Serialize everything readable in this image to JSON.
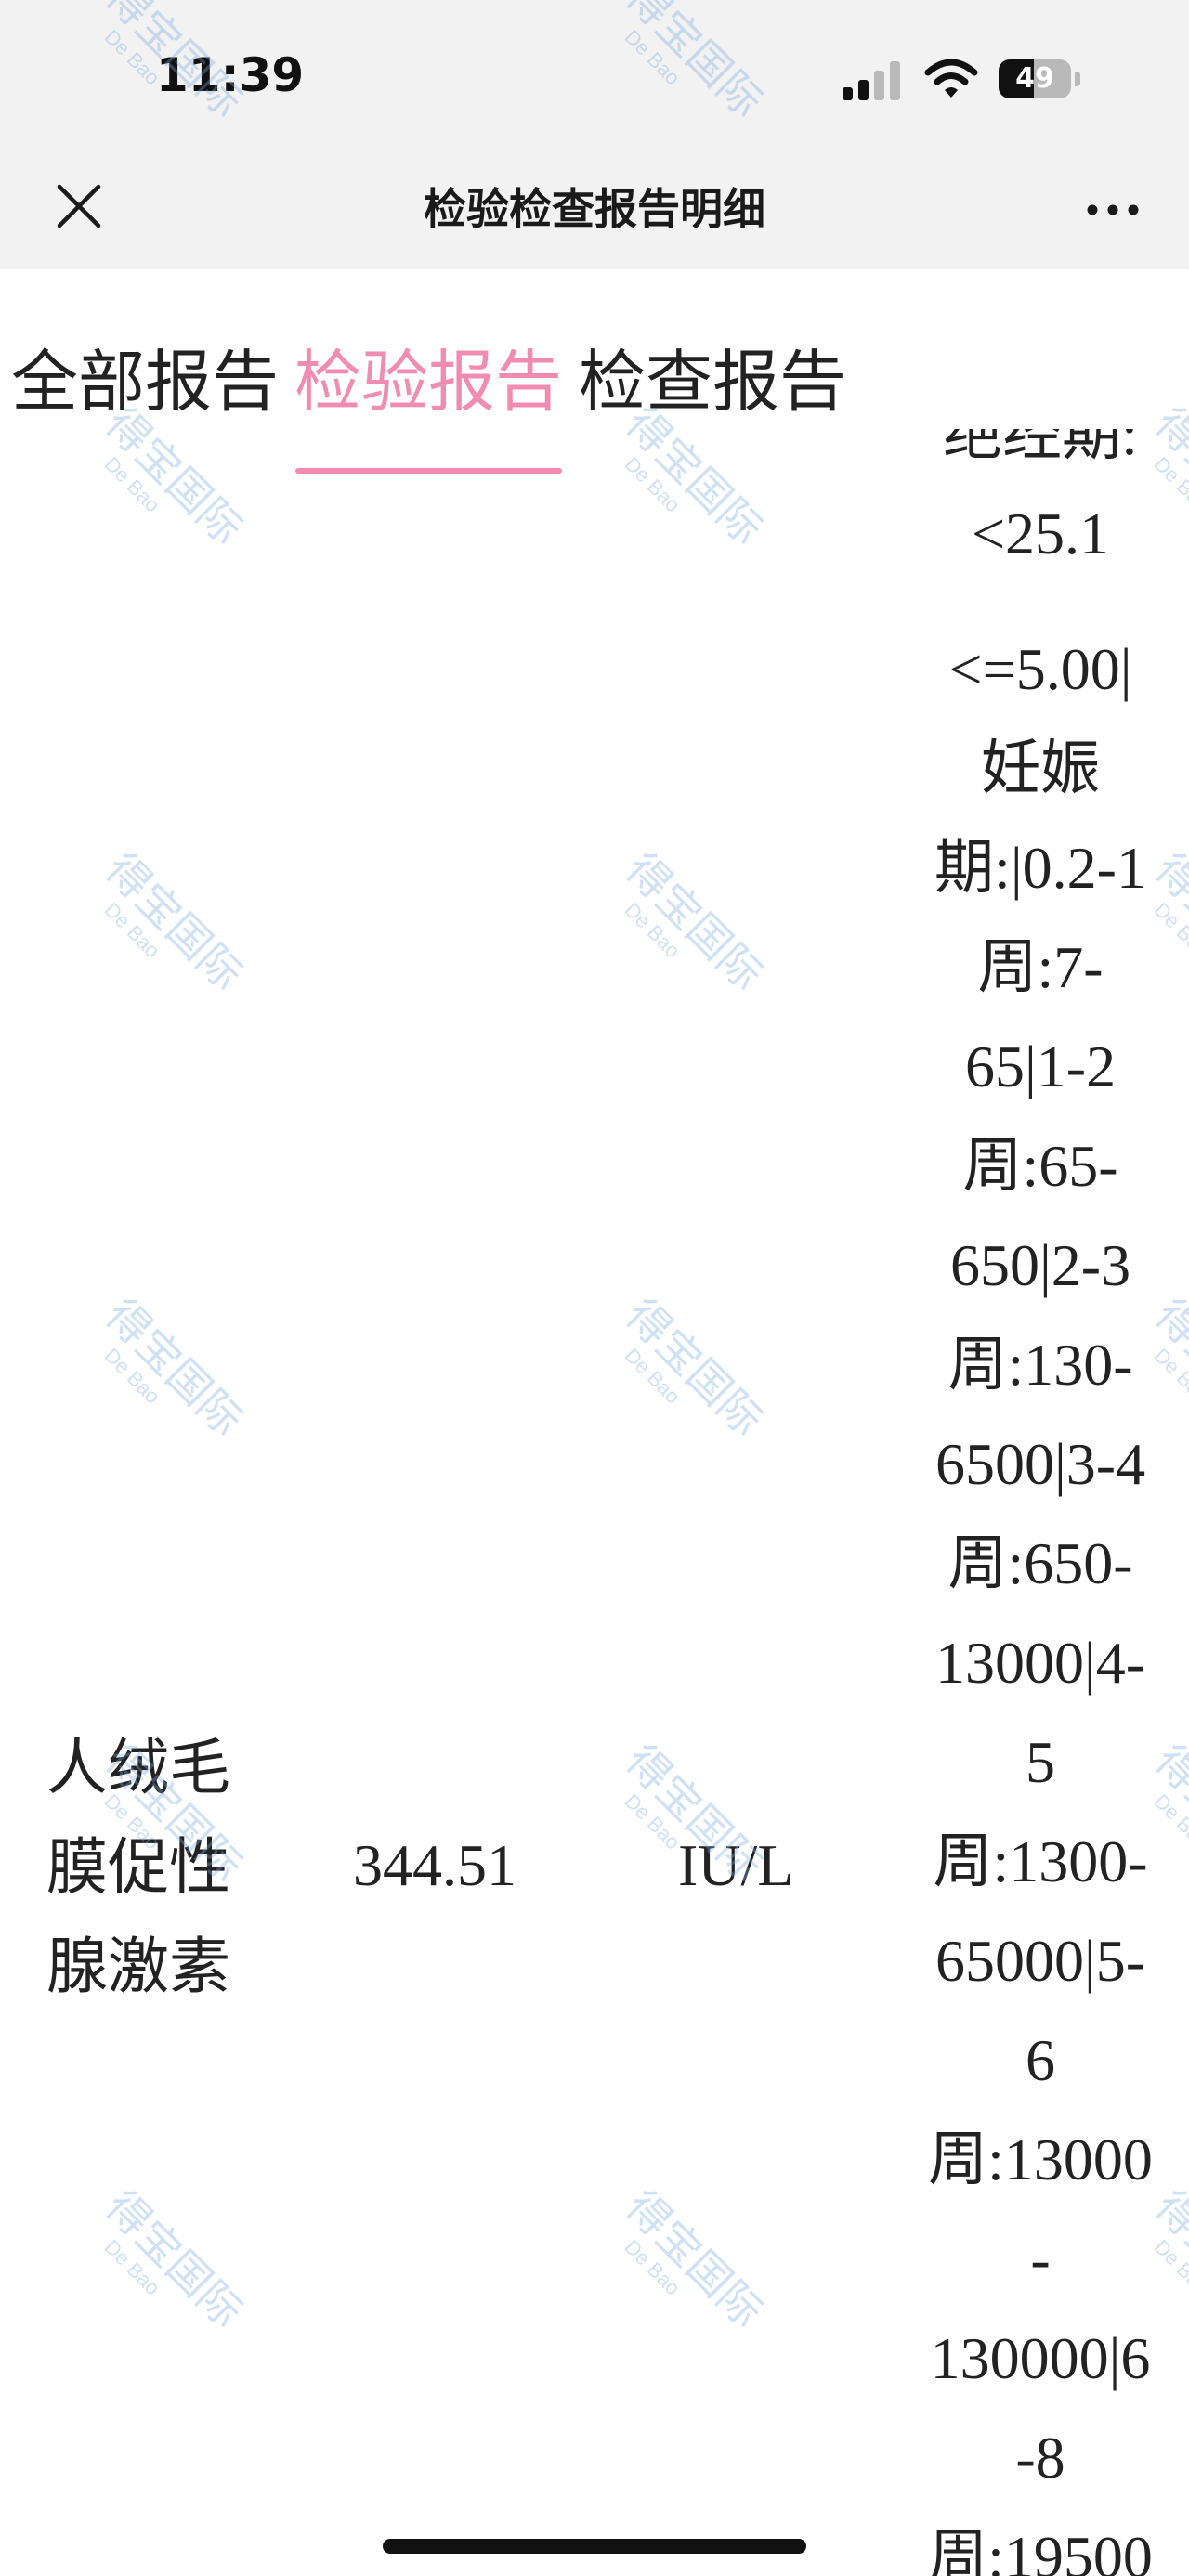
{
  "status_bar": {
    "time": "11:39",
    "battery_percent": "49",
    "battery_level": 0.49,
    "icons": [
      "signal-icon",
      "wifi-icon",
      "battery-icon"
    ]
  },
  "nav": {
    "title": "检验检查报告明细",
    "close_icon": "close-icon",
    "more_icon": "more-icon"
  },
  "tabs": [
    {
      "label": "全部报告",
      "active": false
    },
    {
      "label": "检验报告",
      "active": true
    },
    {
      "label": "检查报告",
      "active": false
    }
  ],
  "colors": {
    "accent": "#f08cb0",
    "bar_background": "#f2f2f2",
    "text": "#222222",
    "watermark": "#78aadc"
  },
  "watermark": {
    "cn": "得宝国际",
    "en": "De Bao"
  },
  "prev_row": {
    "reference_tail": [
      "绝经期:",
      "<25.1"
    ]
  },
  "row": {
    "name_lines": [
      "人绒毛",
      "膜促性",
      "腺激素"
    ],
    "value": "344.51",
    "unit": "IU/L",
    "reference_lines": [
      "<=5.00|",
      "妊娠",
      "期:|0.2-1",
      "周:7-",
      "65|1-2",
      "周:65-",
      "650|2-3",
      "周:130-",
      "6500|3-4",
      "周:650-",
      "13000|4-",
      "5",
      "周:1300-",
      "65000|5-",
      "6",
      "周:13000",
      "-",
      "130000|6",
      "-8",
      "周:19500"
    ]
  }
}
